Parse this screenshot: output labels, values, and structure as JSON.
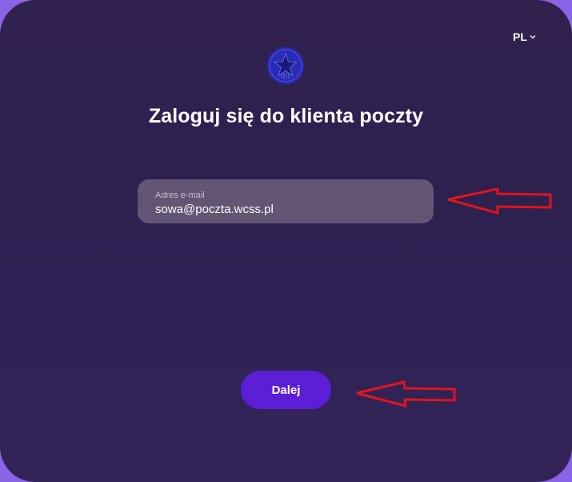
{
  "language_selector": {
    "label": "PL",
    "icon": "chevron-down-icon"
  },
  "logo": {
    "icon": "star-seal-logo",
    "color": "#2a2ab8"
  },
  "title": "Zaloguj się do klienta poczty",
  "email_field": {
    "label": "Adres e-mail",
    "value": "sowa@poczta.wcss.pl"
  },
  "next_button": {
    "label": "Dalej",
    "color": "#5b1ed6"
  },
  "annotations": {
    "color": "#e0141e",
    "arrows": [
      "arrow-to-email-field",
      "arrow-to-next-button"
    ]
  }
}
